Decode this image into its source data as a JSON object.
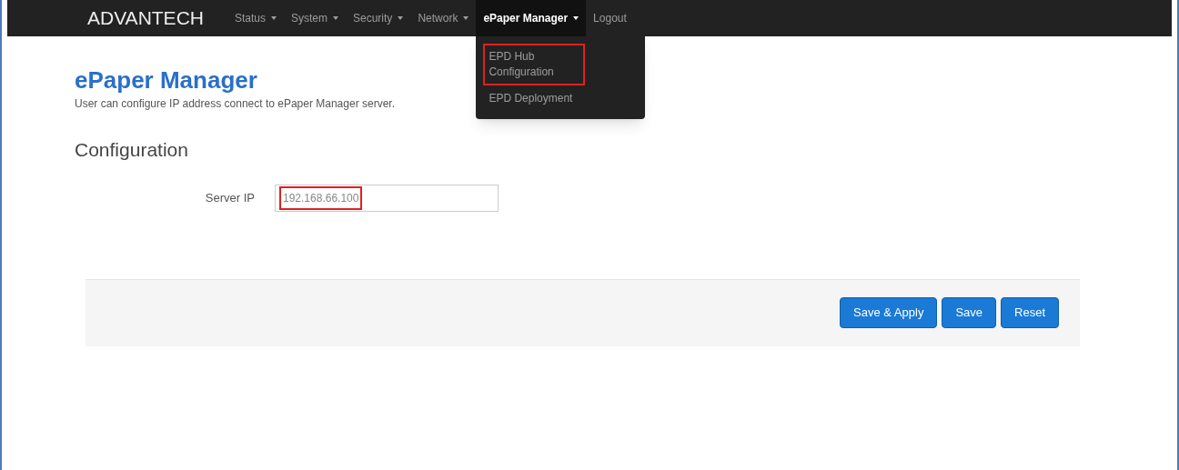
{
  "navbar": {
    "brand": "ADVANTECH",
    "items": [
      {
        "label": "Status",
        "caret": true,
        "selected": false
      },
      {
        "label": "System",
        "caret": true,
        "selected": false
      },
      {
        "label": "Security",
        "caret": true,
        "selected": false
      },
      {
        "label": "Network",
        "caret": true,
        "selected": false
      },
      {
        "label": "ePaper Manager",
        "caret": true,
        "selected": true
      },
      {
        "label": "Logout",
        "caret": false,
        "selected": false
      }
    ]
  },
  "dropdown": {
    "items": [
      {
        "label": "EPD Hub Configuration",
        "highlighted": true
      },
      {
        "label": "EPD Deployment",
        "highlighted": false
      }
    ]
  },
  "page": {
    "title": "ePaper Manager",
    "description": "User can configure IP address connect to ePaper Manager server."
  },
  "section": {
    "title": "Configuration",
    "fields": [
      {
        "label": "Server IP",
        "value": "192.168.66.100",
        "highlighted": true
      }
    ]
  },
  "buttons": [
    "Save & Apply",
    "Save",
    "Reset"
  ]
}
